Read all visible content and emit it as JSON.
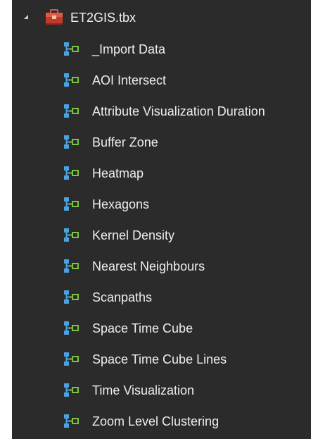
{
  "toolbox": {
    "name": "ET2GIS.tbx",
    "expander_icon": "expanded-triangle-icon",
    "icon": "toolbox-icon",
    "tool_icon": "model-tool-icon",
    "colors": {
      "panel_background": "#2b2b2b",
      "text": "#eeeeee",
      "toolbox_red": "#c0392b",
      "model_blue": "#4aa3df",
      "model_green": "#7cc243"
    },
    "tools": [
      {
        "label": "_Import Data"
      },
      {
        "label": "AOI Intersect"
      },
      {
        "label": "Attribute Visualization Duration"
      },
      {
        "label": "Buffer Zone"
      },
      {
        "label": "Heatmap"
      },
      {
        "label": "Hexagons"
      },
      {
        "label": "Kernel Density"
      },
      {
        "label": "Nearest Neighbours"
      },
      {
        "label": "Scanpaths"
      },
      {
        "label": "Space Time Cube"
      },
      {
        "label": "Space Time Cube Lines"
      },
      {
        "label": "Time Visualization"
      },
      {
        "label": "Zoom Level Clustering"
      }
    ]
  }
}
